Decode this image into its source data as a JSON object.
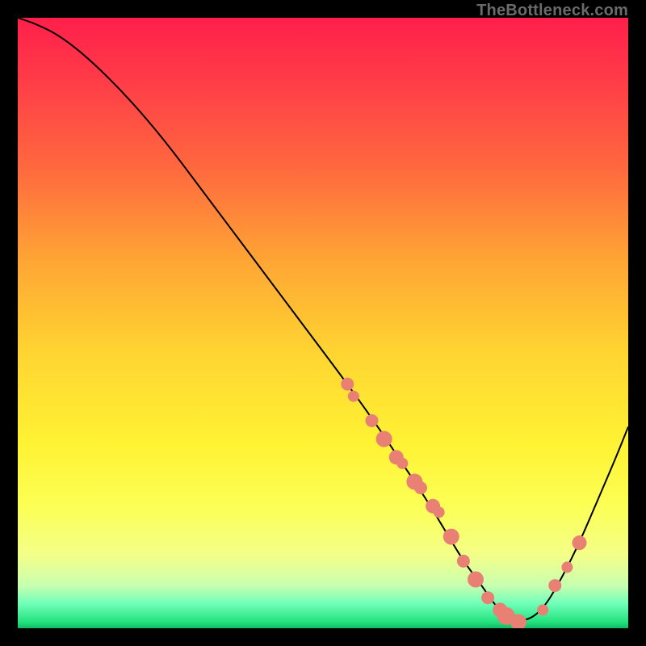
{
  "watermark": "TheBottleneck.com",
  "colors": {
    "curve_stroke": "#000000",
    "dot_fill": "#e88074",
    "dot_stroke": "#c86a60"
  },
  "chart_data": {
    "type": "line",
    "title": "",
    "xlabel": "",
    "ylabel": "",
    "xlim": [
      0,
      100
    ],
    "ylim": [
      0,
      100
    ],
    "grid": false,
    "legend": false,
    "series": [
      {
        "name": "bottleneck-curve",
        "x": [
          0,
          3,
          7,
          12,
          18,
          24,
          30,
          36,
          42,
          48,
          54,
          59,
          63,
          67,
          70,
          73,
          76,
          78,
          80,
          83,
          86,
          89,
          92,
          95,
          98,
          100
        ],
        "values": [
          100,
          99,
          97,
          93,
          87,
          80,
          72,
          64,
          56,
          48,
          40,
          33,
          27,
          21,
          16,
          11,
          7,
          4,
          2,
          1,
          3,
          8,
          14,
          21,
          28,
          33
        ]
      }
    ],
    "dots": {
      "name": "data-points",
      "x": [
        54,
        55,
        58,
        60,
        62,
        63,
        65,
        66,
        68,
        69,
        71,
        73,
        75,
        77,
        79,
        80,
        82,
        86,
        88,
        90,
        92
      ],
      "values": [
        40,
        38,
        34,
        31,
        28,
        27,
        24,
        23,
        20,
        19,
        15,
        11,
        8,
        5,
        3,
        2,
        1,
        3,
        7,
        10,
        14
      ],
      "radius": [
        8,
        7,
        8,
        10,
        9,
        7,
        10,
        8,
        9,
        7,
        10,
        8,
        10,
        8,
        9,
        11,
        10,
        7,
        8,
        7,
        9
      ]
    }
  }
}
